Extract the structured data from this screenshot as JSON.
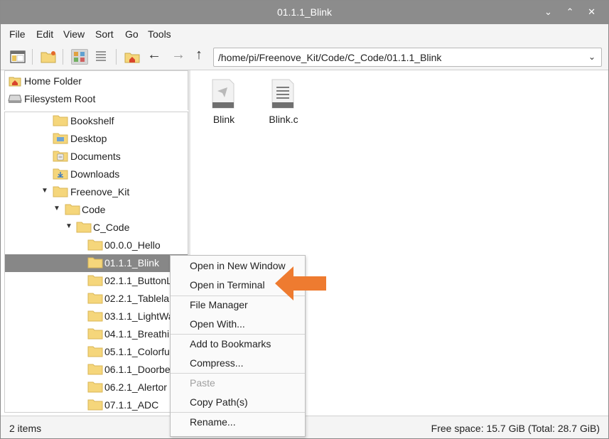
{
  "window": {
    "title": "01.1.1_Blink",
    "controls": [
      "⌄",
      "⌃",
      "✕"
    ]
  },
  "menu": [
    "File",
    "Edit",
    "View",
    "Sort",
    "Go",
    "Tools"
  ],
  "toolbar": {
    "icons": [
      "new-window-icon",
      "new-folder-icon",
      "icon-view-icon",
      "list-view-icon",
      "home-icon"
    ],
    "back": "←",
    "forward": "→",
    "up": "↑",
    "path": "/home/pi/Freenove_Kit/Code/C_Code/01.1.1_Blink",
    "dropdown": "⌄"
  },
  "places": [
    {
      "label": "Home Folder",
      "icon": "home-icon"
    },
    {
      "label": "Filesystem Root",
      "icon": "drive-icon"
    }
  ],
  "tree": [
    {
      "label": "Bookshelf",
      "expanded": null,
      "icon": "folder-icon"
    },
    {
      "label": "Desktop",
      "expanded": null,
      "icon": "desktop-folder-icon"
    },
    {
      "label": "Documents",
      "expanded": null,
      "icon": "documents-folder-icon"
    },
    {
      "label": "Downloads",
      "expanded": null,
      "icon": "downloads-folder-icon"
    },
    {
      "label": "Freenove_Kit",
      "expanded": "▼",
      "icon": "folder-icon"
    },
    {
      "label": "Code",
      "expanded": "▼",
      "icon": "folder-icon"
    },
    {
      "label": "C_Code",
      "expanded": "▼",
      "icon": "folder-icon"
    },
    {
      "label": "00.0.0_Hello",
      "expanded": null,
      "icon": "folder-icon"
    },
    {
      "label": "01.1.1_Blink",
      "expanded": null,
      "icon": "folder-icon",
      "selected": true
    },
    {
      "label": "02.1.1_ButtonLED",
      "expanded": null,
      "icon": "folder-icon"
    },
    {
      "label": "02.2.1_Tablelamp",
      "expanded": null,
      "icon": "folder-icon"
    },
    {
      "label": "03.1.1_LightWater",
      "expanded": null,
      "icon": "folder-icon"
    },
    {
      "label": "04.1.1_BreathingLED",
      "expanded": null,
      "icon": "folder-icon"
    },
    {
      "label": "05.1.1_ColorfulLED",
      "expanded": null,
      "icon": "folder-icon"
    },
    {
      "label": "06.1.1_Doorbell",
      "expanded": null,
      "icon": "folder-icon"
    },
    {
      "label": "06.2.1_Alertor",
      "expanded": null,
      "icon": "folder-icon"
    },
    {
      "label": "07.1.1_ADC",
      "expanded": null,
      "icon": "folder-icon"
    }
  ],
  "files": [
    {
      "name": "Blink",
      "icon": "executable-icon"
    },
    {
      "name": "Blink.c",
      "icon": "text-file-icon"
    }
  ],
  "status": {
    "items": "2 items",
    "free_space": "Free space: 15.7 GiB (Total: 28.7 GiB)"
  },
  "context_menu": {
    "items": [
      {
        "label": "Open in New Window",
        "enabled": true
      },
      {
        "label": "Open in Terminal",
        "enabled": true
      },
      {
        "label": "File Manager",
        "enabled": true
      },
      {
        "label": "Open With...",
        "enabled": true
      },
      {
        "label": "Add to Bookmarks",
        "enabled": true
      },
      {
        "label": "Compress...",
        "enabled": true
      },
      {
        "label": "Paste",
        "enabled": false
      },
      {
        "label": "Copy Path(s)",
        "enabled": true
      },
      {
        "label": "Rename...",
        "enabled": true
      }
    ]
  },
  "colors": {
    "titlebar": "#8c8c8c",
    "selection": "#878787",
    "folder": "#f5d67b",
    "callout_arrow": "#ee7b30"
  }
}
